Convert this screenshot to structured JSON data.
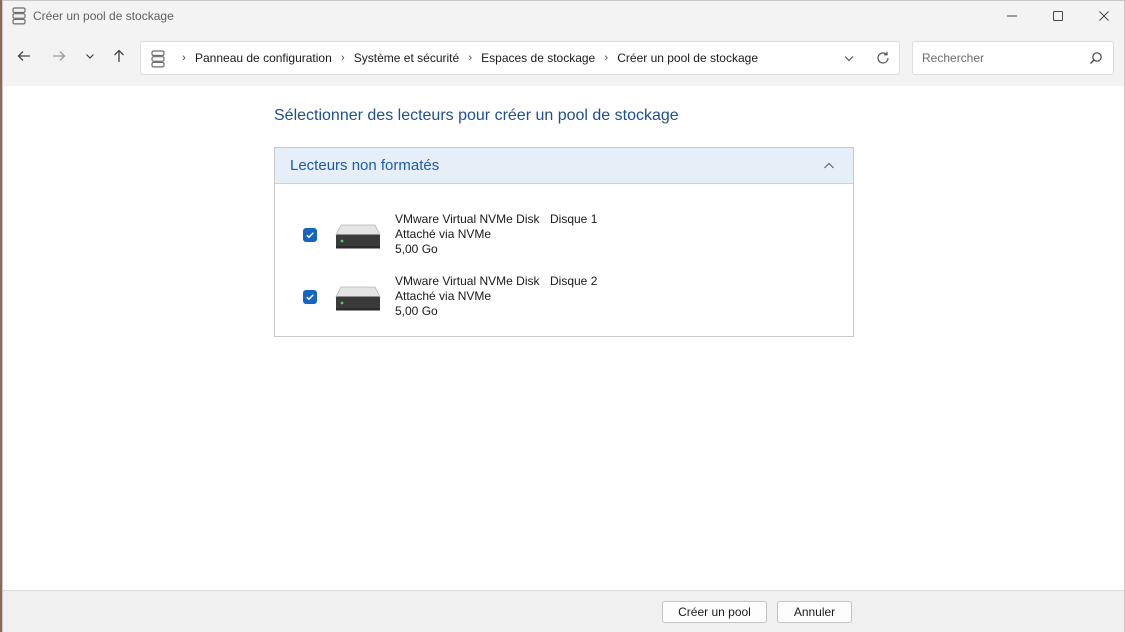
{
  "window": {
    "title": "Créer un pool de stockage"
  },
  "breadcrumb": {
    "items": [
      "Panneau de configuration",
      "Système et sécurité",
      "Espaces de stockage",
      "Créer un pool de stockage"
    ]
  },
  "search": {
    "placeholder": "Rechercher"
  },
  "main": {
    "heading": "Sélectionner des lecteurs pour créer un pool de stockage",
    "group_title": "Lecteurs non formatés",
    "drives": [
      {
        "name": "VMware Virtual NVMe Disk",
        "disk": "Disque 1",
        "connection": "Attaché via NVMe",
        "size": "5,00 Go",
        "checked": true
      },
      {
        "name": "VMware Virtual NVMe Disk",
        "disk": "Disque 2",
        "connection": "Attaché via NVMe",
        "size": "5,00 Go",
        "checked": true
      }
    ]
  },
  "footer": {
    "create_label": "Créer un pool",
    "cancel_label": "Annuler"
  },
  "colors": {
    "accent": "#1565c0",
    "heading": "#1e4f8f",
    "group_header_bg": "#e6eff8"
  },
  "icons": {
    "app": "storage-spaces-icon",
    "drive": "hard-drive-icon"
  }
}
